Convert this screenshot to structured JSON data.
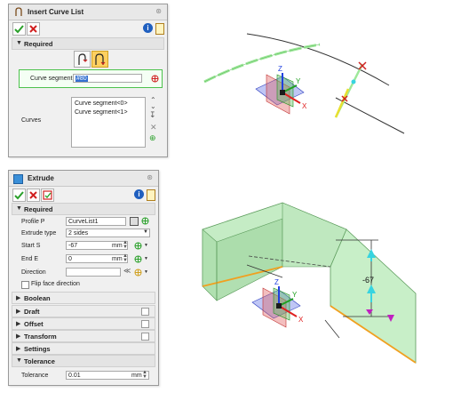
{
  "insert_panel": {
    "title": "Insert Curve List",
    "section": "Required",
    "curve_segment_label": "Curve segment",
    "curve_segment_value": "#80",
    "curves_label": "Curves",
    "curves": [
      "Curve segment<0>",
      "Curve segment<1>"
    ]
  },
  "extrude_panel": {
    "title": "Extrude",
    "required": "Required",
    "profile_label": "Profile P",
    "profile_value": "CurveList1",
    "type_label": "Extrude type",
    "type_value": "2 sides",
    "start_label": "Start S",
    "start_value": "-67",
    "start_unit": "mm",
    "end_label": "End E",
    "end_value": "0",
    "end_unit": "mm",
    "direction_label": "Direction",
    "flip_label": "Flip face direction",
    "sections": [
      "Boolean",
      "Draft",
      "Offset",
      "Transform",
      "Settings"
    ],
    "tolerance_section": "Tolerance",
    "tolerance_label": "Tolerance",
    "tolerance_value": "0.01",
    "tolerance_unit": "mm"
  },
  "viewport": {
    "dimension_value": "-67",
    "triad_top": {
      "x": "X",
      "y": "Y",
      "z": "Z"
    },
    "triad_bottom": {
      "x": "X",
      "y": "Y",
      "z": "Z"
    }
  },
  "colors": {
    "curve_highlight": "#9ee89a",
    "surface_fill": "#bfe8bf",
    "edge_orange": "#f0a020",
    "arrow_cyan": "#37d4e0",
    "marker_magenta": "#c020c0",
    "axis_x": "#e02020",
    "axis_y": "#20a020",
    "axis_z": "#2040e0"
  }
}
